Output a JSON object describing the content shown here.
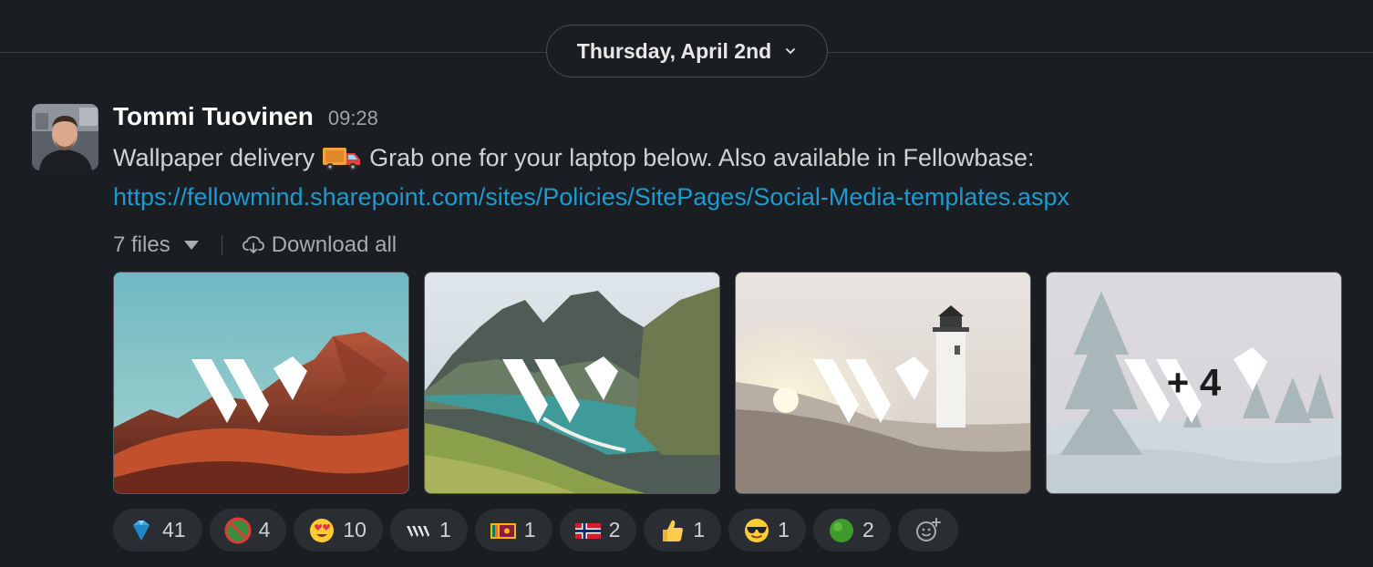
{
  "divider": {
    "date_label": "Thursday, April 2nd"
  },
  "message": {
    "author": "Tommi Tuovinen",
    "time": "09:28",
    "text_before": "Wallpaper delivery",
    "emoji_name": "delivery-truck-icon",
    "text_after": "Grab one for your laptop below. Also available in Fellowbase:",
    "link": "https://fellowmind.sharepoint.com/sites/Policies/SitePages/Social-Media-templates.aspx"
  },
  "files": {
    "count_label": "7 files",
    "download_label": "Download all",
    "more_label": "+ 4",
    "thumbnails": [
      {
        "name": "wallpaper-red-mountains"
      },
      {
        "name": "wallpaper-green-fjord"
      },
      {
        "name": "wallpaper-lighthouse-dunes"
      },
      {
        "name": "wallpaper-snowy-forest"
      }
    ]
  },
  "reactions": [
    {
      "icon": "gem-icon",
      "count": "41"
    },
    {
      "icon": "no-entry-icon",
      "count": "4"
    },
    {
      "icon": "heart-eyes-icon",
      "count": "10"
    },
    {
      "icon": "fellowmind-logo-icon",
      "count": "1"
    },
    {
      "icon": "sri-lanka-flag-icon",
      "count": "1"
    },
    {
      "icon": "norway-flag-icon",
      "count": "2"
    },
    {
      "icon": "thumbs-up-icon",
      "count": "1"
    },
    {
      "icon": "sunglasses-icon",
      "count": "1"
    },
    {
      "icon": "green-ball-icon",
      "count": "2"
    }
  ],
  "colors": {
    "background": "#1a1d21",
    "link": "#1d9bd1",
    "reaction_bg": "#2a2d31"
  }
}
